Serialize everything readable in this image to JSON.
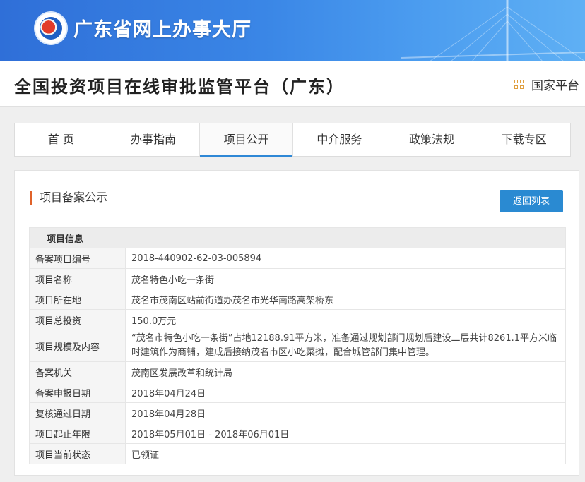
{
  "banner": {
    "title": "广东省网上办事大厅"
  },
  "platform": {
    "title": "全国投资项目在线审批监管平台（广东）",
    "national_link": "国家平台"
  },
  "nav": {
    "items": [
      {
        "label": "首 页"
      },
      {
        "label": "办事指南"
      },
      {
        "label": "项目公开"
      },
      {
        "label": "中介服务"
      },
      {
        "label": "政策法规"
      },
      {
        "label": "下载专区"
      }
    ],
    "active_index": 2
  },
  "panel": {
    "section_title": "项目备案公示",
    "back_button": "返回列表",
    "table_header": "项目信息",
    "rows": [
      {
        "label": "备案项目编号",
        "value": "2018-440902-62-03-005894"
      },
      {
        "label": "项目名称",
        "value": "茂名特色小吃一条街"
      },
      {
        "label": "项目所在地",
        "value": "茂名市茂南区站前街道办茂名市光华南路高架桥东"
      },
      {
        "label": "项目总投资",
        "value": "150.0万元"
      },
      {
        "label": "项目规模及内容",
        "value": "“茂名市特色小吃一条街”占地12188.91平方米，准备通过规划部门规划后建设二层共计8261.1平方米临时建筑作为商铺，建成后接纳茂名市区小吃菜摊，配合城管部门集中管理。"
      },
      {
        "label": "备案机关",
        "value": "茂南区发展改革和统计局"
      },
      {
        "label": "备案申报日期",
        "value": "2018年04月24日"
      },
      {
        "label": "复核通过日期",
        "value": "2018年04月28日"
      },
      {
        "label": "项目起止年限",
        "value": "2018年05月01日 - 2018年06月01日"
      },
      {
        "label": "项目当前状态",
        "value": "已领证"
      }
    ]
  },
  "colors": {
    "banner": "#3a86e6",
    "accent": "#2a8ad2",
    "section_marker": "#e0622a"
  },
  "icons": {
    "logo": "guangdong-logo-icon",
    "national": "grid-icon"
  }
}
